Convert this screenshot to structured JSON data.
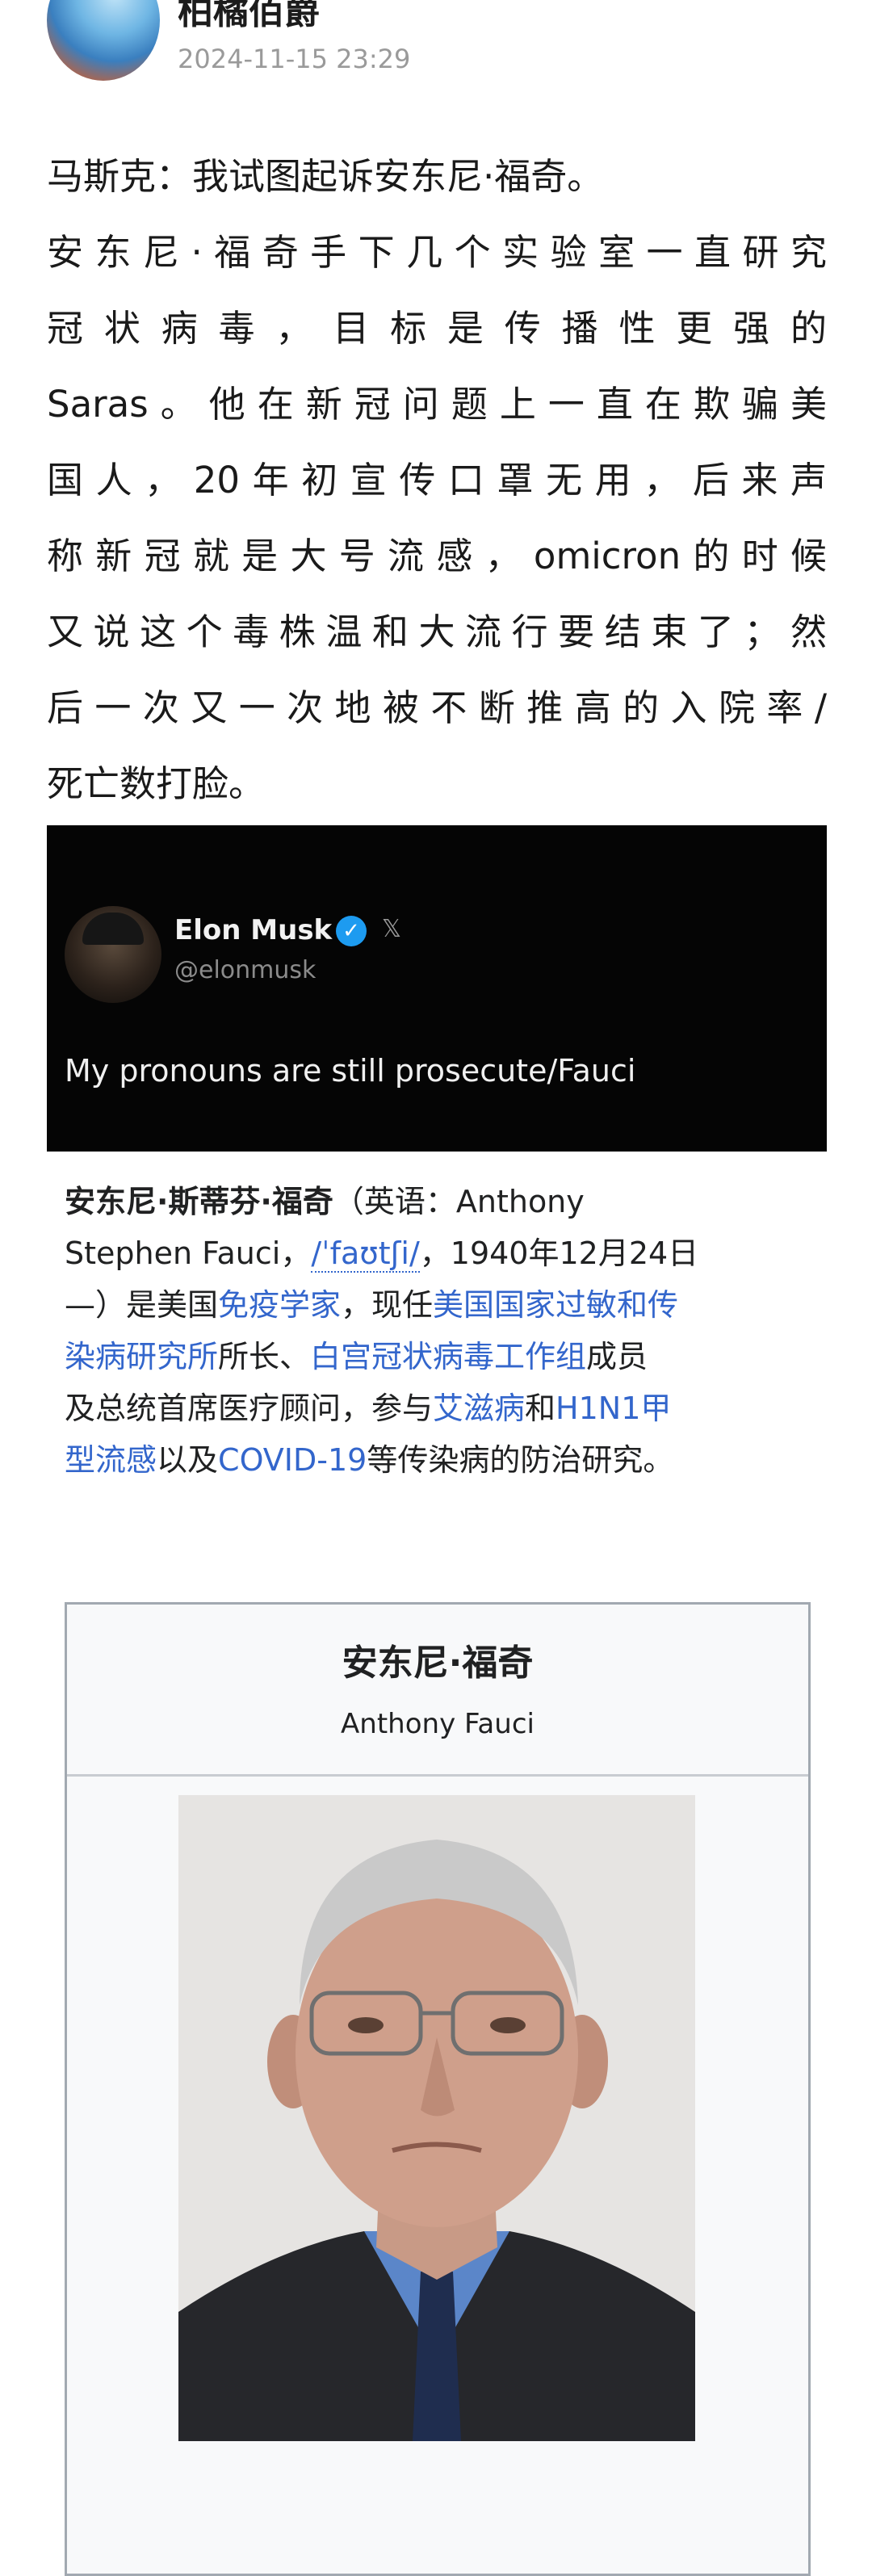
{
  "header": {
    "author_name": "柏橘佰爵",
    "timestamp": "2024-11-15 23:29"
  },
  "post": {
    "paragraphs": [
      "马斯克：我试图起诉安东尼·福奇。",
      "安东尼·福奇手下几个实验室一直研究",
      "冠状病毒，目标是传播性更强的",
      "Saras。他在新冠问题上一直在欺骗美",
      "国人，20年初宣传口罩无用，后来声",
      "称新冠就是大号流感，omicron的时候",
      "又说这个毒株温和大流行要结束了；然",
      "后一次又一次地被不断推高的入院率/",
      "死亡数打脸。"
    ]
  },
  "tweet": {
    "name": "Elon Musk",
    "handle": "@elonmusk",
    "verified_mark": "✓",
    "x_mark": "𝕏",
    "text": "My pronouns are still prosecute/Fauci"
  },
  "wiki": {
    "name_bold": "安东尼·斯蒂芬·福奇",
    "paren_open": "（英语：Anthony",
    "line2_a": "Stephen Fauci，",
    "ipa": "/ˈfaʊtʃi/",
    "line2_b": "，1940年12月24日",
    "line3_a": "—）是美国",
    "link_immunologist": "免疫学家",
    "line3_b": "，现任",
    "link_niaid_1": "美国国家过敏和传",
    "link_niaid_2": "染病研究所",
    "line4_a": "所长、",
    "link_task_force": "白宫冠状病毒工作组",
    "line4_b": "成员",
    "line5_a": "及总统首席医疗顾问，参与",
    "link_aids": "艾滋病",
    "line5_b": "和",
    "link_h1n1_1": "H1N1甲",
    "link_h1n1_2": "型流感",
    "line6_a": "以及",
    "link_covid": "COVID-19",
    "line6_b": "等传染病的防治研究。"
  },
  "infobox": {
    "title": "安东尼·福奇",
    "subtitle": "Anthony Fauci"
  },
  "colors": {
    "link": "#3366cc",
    "tweet_bg": "#050505",
    "verified": "#1d9bf0",
    "meta_gray": "#9a9a9a"
  }
}
